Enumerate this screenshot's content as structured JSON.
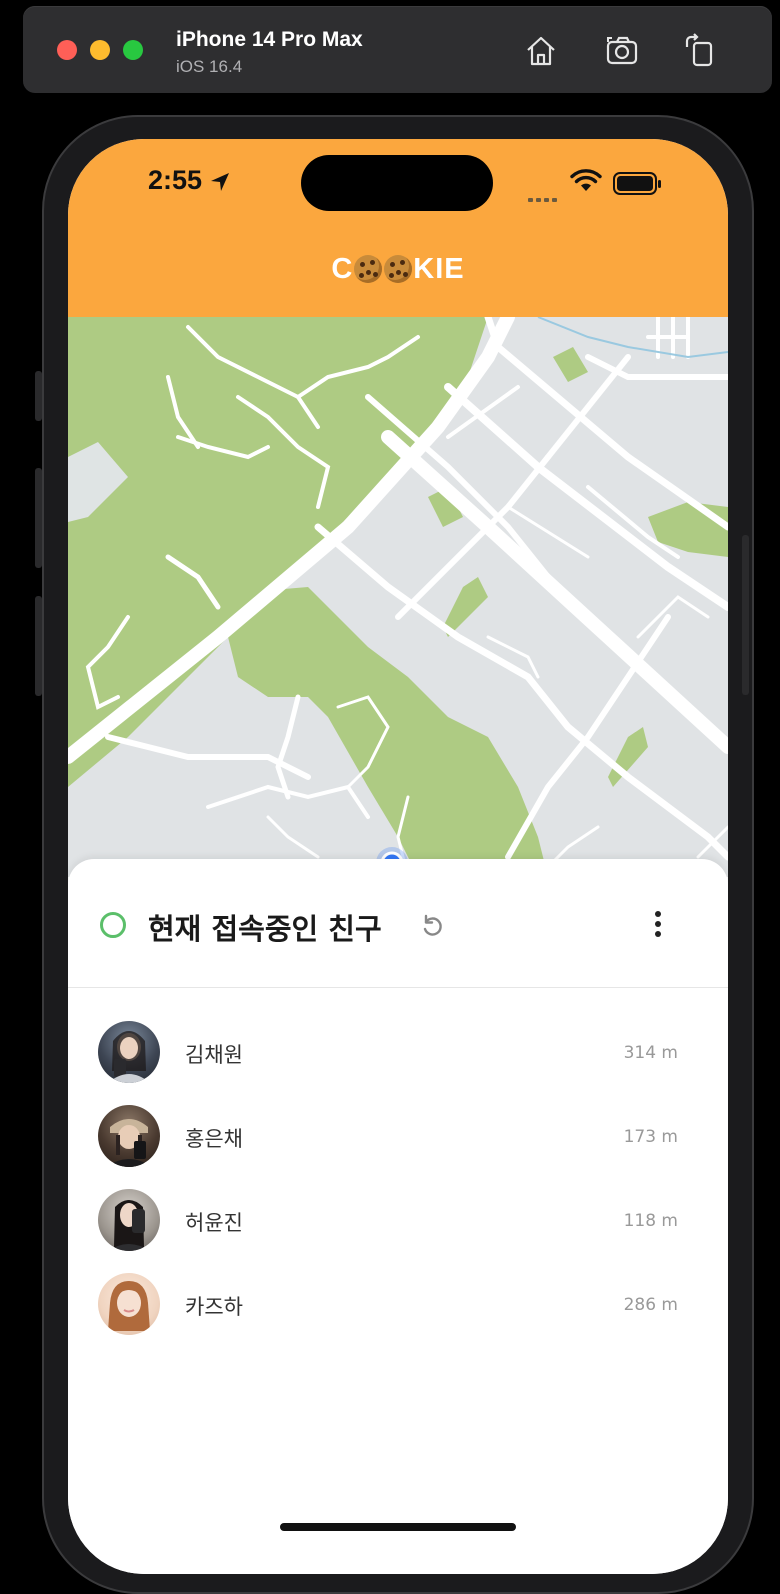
{
  "simulator": {
    "device_name": "iPhone 14 Pro Max",
    "os_version": "iOS 16.4",
    "buttons": [
      "home-icon",
      "screenshot-icon",
      "rotate-icon"
    ]
  },
  "status_bar": {
    "time": "2:55"
  },
  "header": {
    "title_prefix": "C",
    "title_suffix": "KIE"
  },
  "sheet": {
    "title": "현재 접속중인 친구"
  },
  "friends": [
    {
      "name": "김채원",
      "distance": "314 m"
    },
    {
      "name": "홍은채",
      "distance": "173 m"
    },
    {
      "name": "허윤진",
      "distance": "118 m"
    },
    {
      "name": "카즈하",
      "distance": "286 m"
    }
  ],
  "colors": {
    "header": "#fba73e",
    "online": "#5bbf6a",
    "map_bg": "#e0e3e5",
    "park": "#aecb83",
    "location_dot": "#3478f6"
  }
}
